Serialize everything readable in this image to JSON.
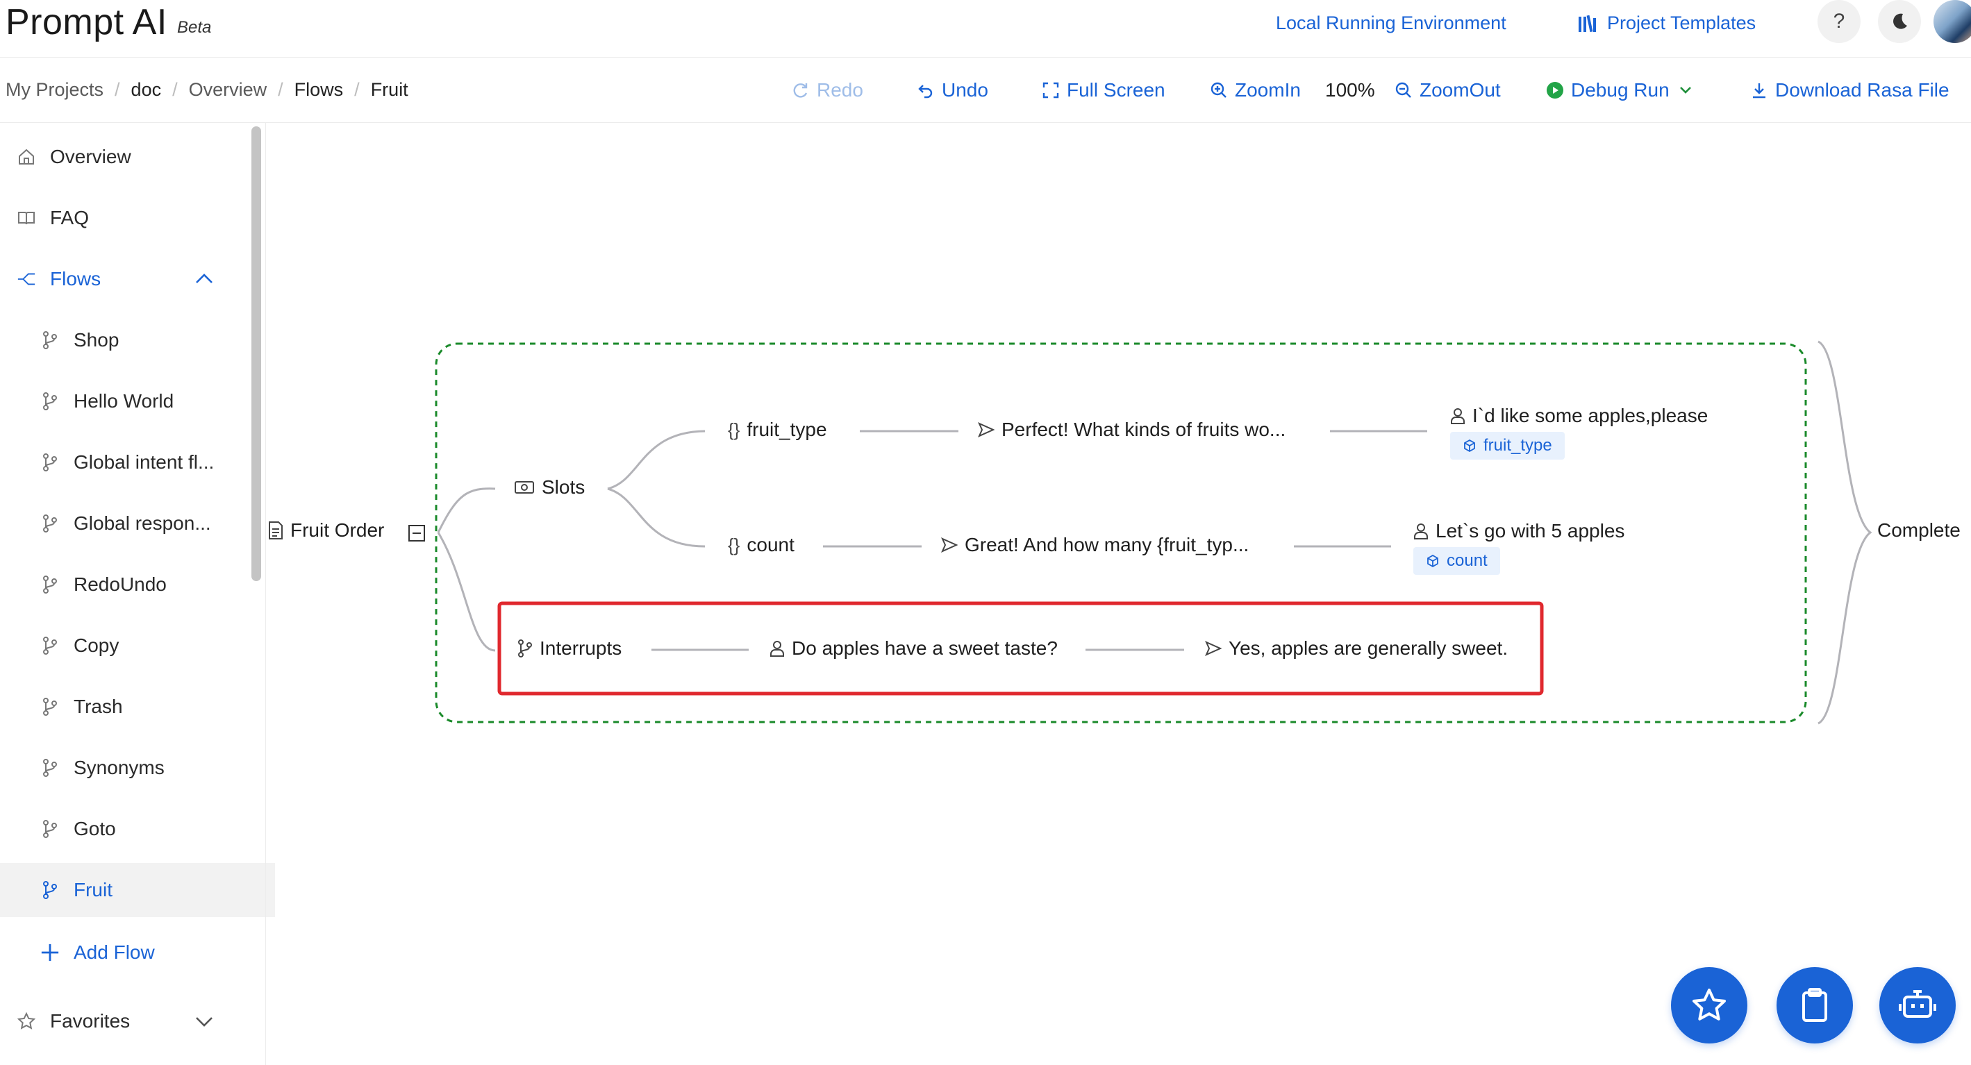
{
  "app": {
    "name": "Prompt AI",
    "badge": "Beta"
  },
  "header": {
    "env_link": "Local Running Environment",
    "templates_link": "Project Templates",
    "help_label": "?"
  },
  "breadcrumb": [
    "My Projects",
    "doc",
    "Overview",
    "Flows",
    "Fruit"
  ],
  "toolbar": {
    "redo": "Redo",
    "undo": "Undo",
    "fullscreen": "Full Screen",
    "zoom_in": "ZoomIn",
    "zoom_level": "100%",
    "zoom_out": "ZoomOut",
    "debug_run": "Debug Run",
    "download": "Download Rasa File"
  },
  "sidebar": {
    "overview": "Overview",
    "faq": "FAQ",
    "flows_label": "Flows",
    "flows": [
      {
        "label": "Shop"
      },
      {
        "label": "Hello World"
      },
      {
        "label": "Global intent fl..."
      },
      {
        "label": "Global respon..."
      },
      {
        "label": "RedoUndo"
      },
      {
        "label": "Copy"
      },
      {
        "label": "Trash"
      },
      {
        "label": "Synonyms"
      },
      {
        "label": "Goto"
      },
      {
        "label": "Fruit",
        "selected": true
      }
    ],
    "add_flow": "Add Flow",
    "favorites": "Favorites"
  },
  "flow": {
    "root": "Fruit Order",
    "slots": "Slots",
    "slot1": {
      "name": "fruit_type",
      "bot": "Perfect! What kinds of fruits wo...",
      "user": "I`d like some apples,please",
      "tag": "fruit_type"
    },
    "slot2": {
      "name": "count",
      "bot": "Great! And how many {fruit_typ...",
      "user": "Let`s go with 5 apples",
      "tag": "count"
    },
    "interrupts": {
      "label": "Interrupts",
      "user": "Do apples have a sweet taste?",
      "bot": "Yes, apples are generally sweet."
    },
    "complete": "Complete"
  },
  "colors": {
    "accent": "#1a63d6",
    "debug_green": "#1f8f3a",
    "dashed_group": "#1a8a2a",
    "highlight_box": "#e0282e"
  }
}
